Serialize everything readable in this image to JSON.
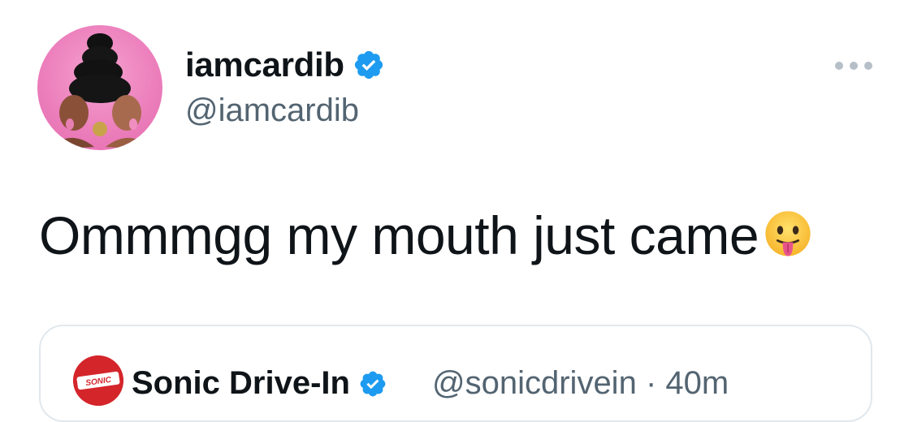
{
  "tweet": {
    "author": {
      "name": "iamcardib",
      "handle": "@iamcardib",
      "verified": true
    },
    "text": "Ommmgg my mouth just came",
    "emoji": "face-with-tongue",
    "more_menu_icon": "more-horizontal-icon"
  },
  "quoted_tweet": {
    "avatar_text": "SONIC",
    "author": {
      "name": "Sonic Drive-In",
      "handle": "@sonicdrivein",
      "verified": true
    },
    "separator": "·",
    "time": "40m"
  },
  "colors": {
    "verified_blue": "#1d9bf0",
    "secondary_text": "#536471",
    "card_border": "#e1e8ed",
    "sonic_red": "#d4252b"
  }
}
